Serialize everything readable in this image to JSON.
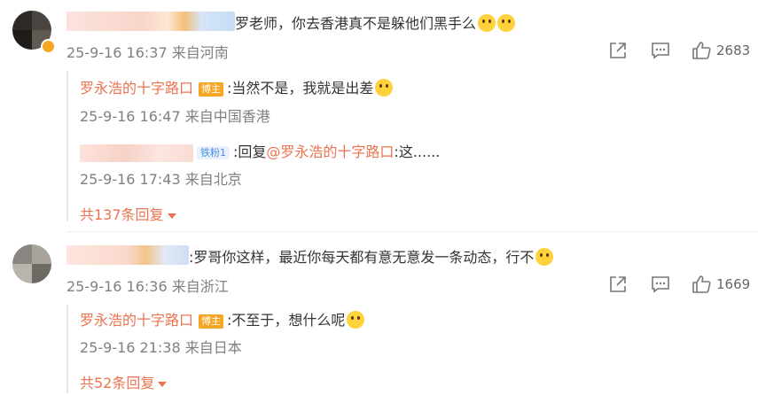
{
  "comments": [
    {
      "text": "罗老师，你去香港真不是躲他们黑手么",
      "meta": "25-9-16 16:37 来自河南",
      "likes": "2683",
      "replies": [
        {
          "author": "罗永浩的十字路口",
          "badge": "博主",
          "text": ":当然不是，我就是出差",
          "meta": "25-9-16 16:47 来自中国香港"
        },
        {
          "badge": "铁粉1",
          "prefix": ":回复",
          "mention": "@罗永浩的十字路口",
          "text": ":这......",
          "meta": "25-9-16 17:43 来自北京"
        }
      ],
      "more_label": "共137条回复"
    },
    {
      "text": ":罗哥你这样，最近你每天都有意无意发一条动态，行不",
      "meta": "25-9-16 16:36 来自浙江",
      "likes": "1669",
      "replies": [
        {
          "author": "罗永浩的十字路口",
          "badge": "博主",
          "text": ":不至于，想什么呢",
          "meta": "25-9-16 21:38 来自日本"
        }
      ],
      "more_label": "共52条回复"
    }
  ],
  "icons": [
    "share-icon",
    "comment-icon",
    "like-icon"
  ],
  "colors": {
    "accent": "#eb7350",
    "badge": "#f5a623",
    "meta": "#808080"
  }
}
